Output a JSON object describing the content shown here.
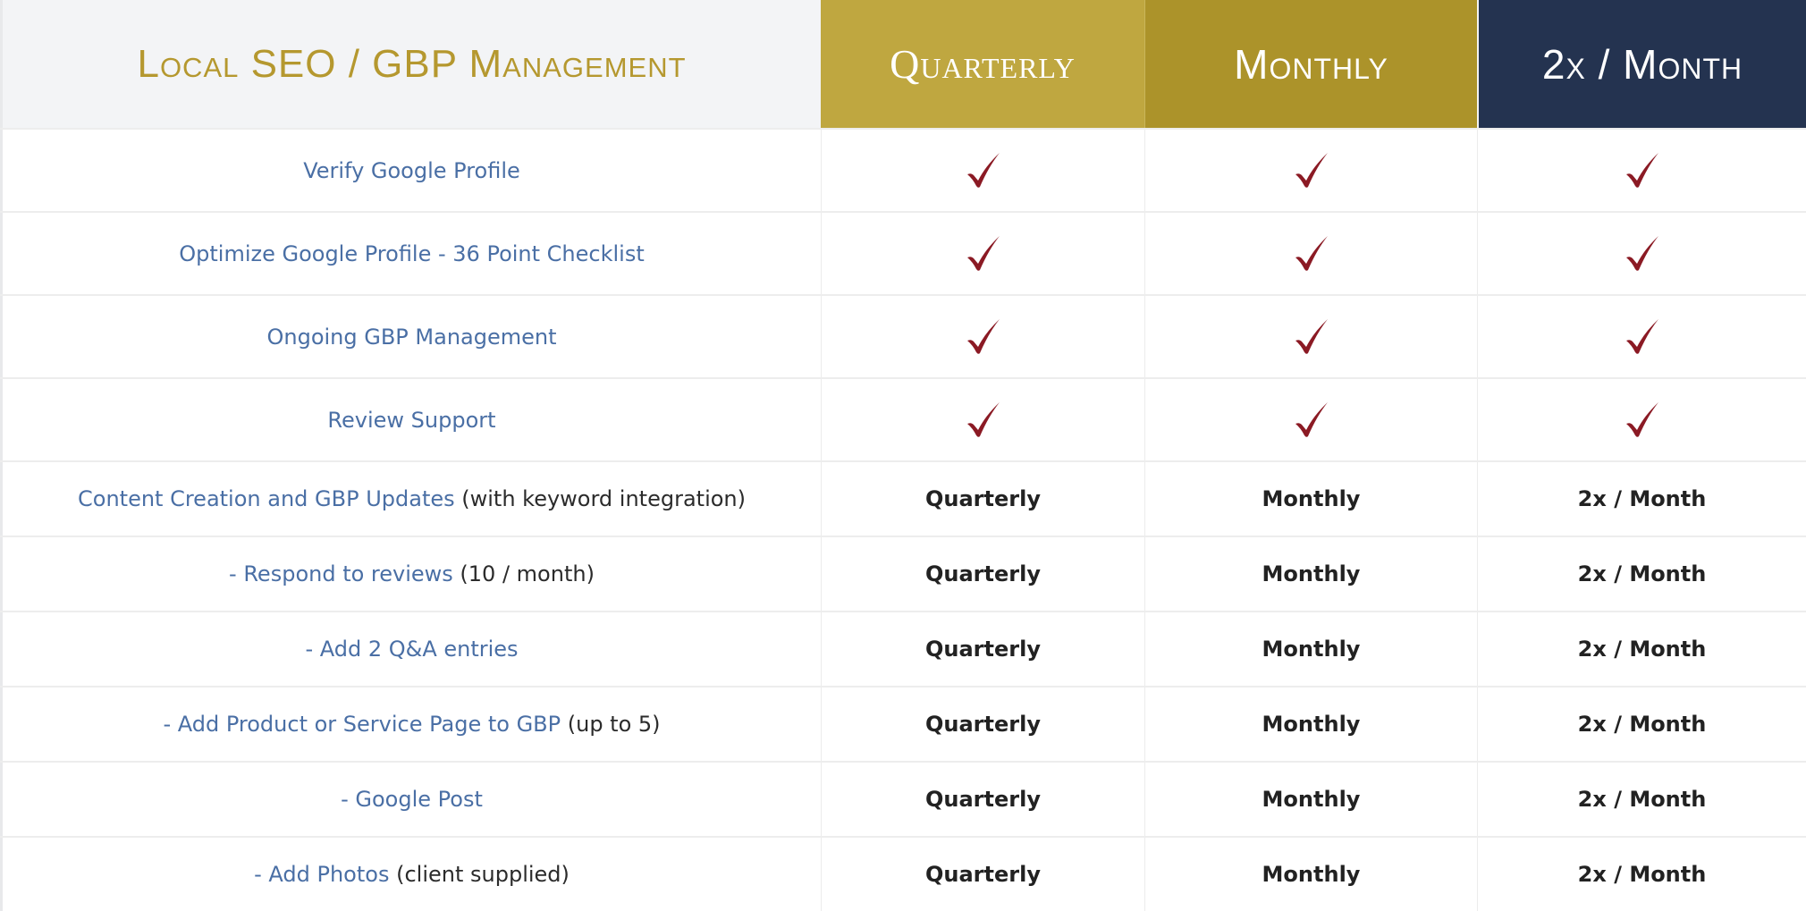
{
  "header": {
    "title": "Local SEO / GBP Management",
    "columns": [
      "Quarterly",
      "Monthly",
      "2x / Month"
    ]
  },
  "colors": {
    "title_gold": "#b5982f",
    "quarterly_bg": "#bfa740",
    "monthly_bg": "#ac932a",
    "twice_monthly_bg": "#243350",
    "feature_blue": "#4a6fa5",
    "check_red": "#8b1a24"
  },
  "check_rows": [
    {
      "feature": "Verify Google Profile",
      "icons": [
        "checkmark-icon",
        "checkmark-icon",
        "checkmark-icon"
      ]
    },
    {
      "feature": "Optimize Google Profile - 36 Point Checklist",
      "icons": [
        "checkmark-icon",
        "checkmark-icon",
        "checkmark-icon"
      ]
    },
    {
      "feature": "Ongoing GBP Management",
      "icons": [
        "checkmark-icon",
        "checkmark-icon",
        "checkmark-icon"
      ]
    },
    {
      "feature": "Review Support",
      "icons": [
        "checkmark-icon",
        "checkmark-icon",
        "checkmark-icon"
      ]
    }
  ],
  "text_rows": [
    {
      "feature": "Content Creation and GBP Updates",
      "note": " (with keyword integration)",
      "values": [
        "Quarterly",
        "Monthly",
        "2x / Month"
      ]
    },
    {
      "feature": "- Respond to reviews",
      "note": " (10 / month)",
      "values": [
        "Quarterly",
        "Monthly",
        "2x / Month"
      ]
    },
    {
      "feature": "- Add 2 Q&A entries",
      "note": "",
      "values": [
        "Quarterly",
        "Monthly",
        "2x / Month"
      ]
    },
    {
      "feature": "- Add Product or Service Page to GBP",
      "note": " (up to 5)",
      "values": [
        "Quarterly",
        "Monthly",
        "2x / Month"
      ]
    },
    {
      "feature": "- Google Post",
      "note": "",
      "values": [
        "Quarterly",
        "Monthly",
        "2x / Month"
      ]
    },
    {
      "feature": "- Add Photos",
      "note": " (client supplied)",
      "values": [
        "Quarterly",
        "Monthly",
        "2x / Month"
      ]
    }
  ]
}
